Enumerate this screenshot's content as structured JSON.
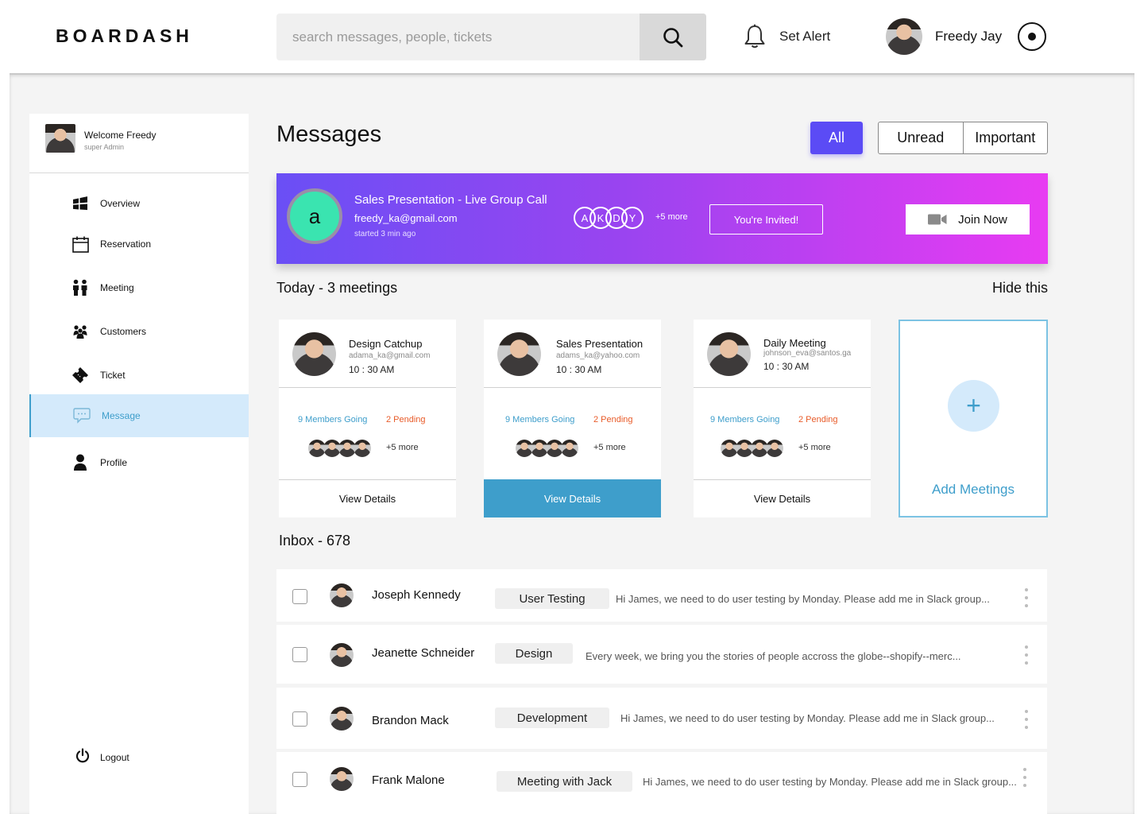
{
  "header": {
    "logo": "BOARDASH",
    "search_placeholder": "search messages, people, tickets",
    "set_alert": "Set Alert",
    "user_name": "Freedy Jay"
  },
  "sidebar": {
    "welcome_title": "Welcome Freedy",
    "welcome_role": "super Admin",
    "items": [
      {
        "label": "Overview",
        "icon": "windows-icon"
      },
      {
        "label": "Reservation",
        "icon": "calendar-icon"
      },
      {
        "label": "Meeting",
        "icon": "people-icon"
      },
      {
        "label": "Customers",
        "icon": "group-icon"
      },
      {
        "label": "Ticket",
        "icon": "ticket-icon"
      },
      {
        "label": "Message",
        "icon": "chat-icon",
        "active": true
      },
      {
        "label": "Profile",
        "icon": "user-icon"
      }
    ],
    "logout": "Logout"
  },
  "main": {
    "title": "Messages",
    "filters": {
      "all": "All",
      "unread": "Unread",
      "important": "Important",
      "active": "All"
    },
    "banner": {
      "avatar_letter": "a",
      "title": "Sales Presentation  -  Live Group Call",
      "email": "freedy_ka@gmail.com",
      "started": "started 3 min ago",
      "initials": [
        "A",
        "K",
        "D",
        "Y"
      ],
      "more": "+5 more",
      "invited": "You're Invited!",
      "join": "Join Now"
    },
    "today_label": "Today  -  3 meetings",
    "hide_label": "Hide this",
    "meetings": [
      {
        "title": "Design Catchup",
        "email": "adama_ka@gmail.com",
        "time": "10 : 30 AM",
        "going": "9 Members Going",
        "pending": "2 Pending",
        "more": "+5 more",
        "button": "View Details",
        "highlighted": false
      },
      {
        "title": "Sales Presentation",
        "email": "adams_ka@yahoo.com",
        "time": "10 : 30 AM",
        "going": "9 Members Going",
        "pending": "2 Pending",
        "more": "+5 more",
        "button": "View Details",
        "highlighted": true
      },
      {
        "title": "Daily Meeting",
        "email": "johnson_eva@santos.ga",
        "time": "10 : 30 AM",
        "going": "9 Members Going",
        "pending": "2 Pending",
        "more": "+5 more",
        "button": "View Details",
        "highlighted": false
      }
    ],
    "add_meetings": "Add Meetings",
    "inbox_title": "Inbox - 678",
    "inbox": [
      {
        "name": "Joseph Kennedy",
        "tag": "User  Testing",
        "message": "Hi James, we need to do user testing by Monday. Please add me in Slack group..."
      },
      {
        "name": "Jeanette Schneider",
        "tag": "Design",
        "message": "Every week, we bring you the stories of people accross the globe--shopify--merc..."
      },
      {
        "name": "Brandon Mack",
        "tag": "Development",
        "message": "Hi James, we need to do user testing by Monday. Please add me in Slack group..."
      },
      {
        "name": "Frank Malone",
        "tag": "Meeting with Jack",
        "message": "Hi James, we need to do user testing by Monday. Please add me in Slack group..."
      }
    ]
  },
  "colors": {
    "accent": "#5b4bf5",
    "primary_blue": "#3e9ecb",
    "pending": "#e85b29",
    "banner_start": "#6a4ff5",
    "banner_end": "#e83bf2"
  }
}
